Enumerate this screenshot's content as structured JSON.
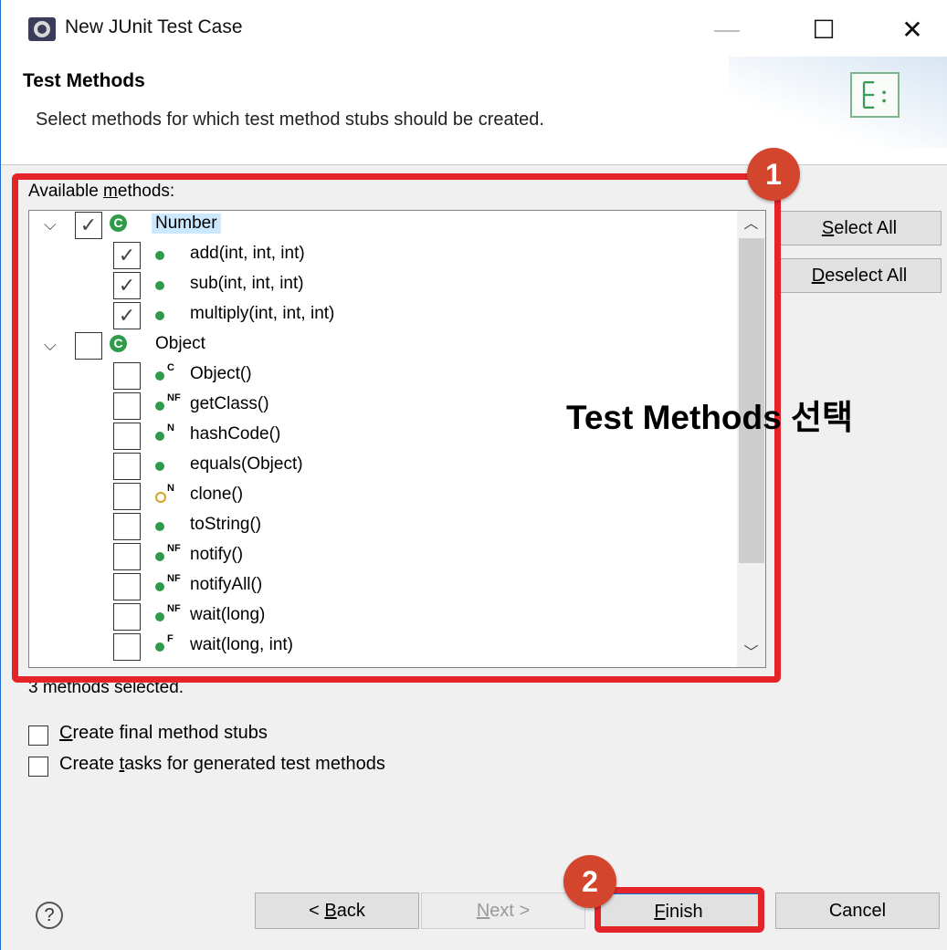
{
  "window": {
    "title": "New JUnit Test Case",
    "minimize": "—",
    "maximize": "☐",
    "close": "✕"
  },
  "header": {
    "title": "Test Methods",
    "description": "Select methods for which test method stubs should be created."
  },
  "tree": {
    "label": "Available methods:",
    "items": [
      {
        "label": "Number",
        "level": 0,
        "checked": true,
        "icon": "class-icon"
      },
      {
        "label": "add(int, int, int)",
        "level": 1,
        "checked": true,
        "icon": "public-method-icon",
        "modifier": ""
      },
      {
        "label": "sub(int, int, int)",
        "level": 1,
        "checked": true,
        "icon": "public-method-icon",
        "modifier": ""
      },
      {
        "label": "multiply(int, int, int)",
        "level": 1,
        "checked": true,
        "icon": "public-method-icon",
        "modifier": ""
      },
      {
        "label": "Object",
        "level": 0,
        "checked": false,
        "icon": "class-icon"
      },
      {
        "label": "Object()",
        "level": 1,
        "checked": false,
        "icon": "public-method-icon",
        "modifier": "C"
      },
      {
        "label": "getClass()",
        "level": 1,
        "checked": false,
        "icon": "public-method-icon",
        "modifier": "NF"
      },
      {
        "label": "hashCode()",
        "level": 1,
        "checked": false,
        "icon": "public-method-icon",
        "modifier": "N"
      },
      {
        "label": "equals(Object)",
        "level": 1,
        "checked": false,
        "icon": "public-method-icon",
        "modifier": ""
      },
      {
        "label": "clone()",
        "level": 1,
        "checked": false,
        "icon": "protected-method-icon",
        "modifier": "N"
      },
      {
        "label": "toString()",
        "level": 1,
        "checked": false,
        "icon": "public-method-icon",
        "modifier": ""
      },
      {
        "label": "notify()",
        "level": 1,
        "checked": false,
        "icon": "public-method-icon",
        "modifier": "NF"
      },
      {
        "label": "notifyAll()",
        "level": 1,
        "checked": false,
        "icon": "public-method-icon",
        "modifier": "NF"
      },
      {
        "label": "wait(long)",
        "level": 1,
        "checked": false,
        "icon": "public-method-icon",
        "modifier": "NF"
      },
      {
        "label": "wait(long, int)",
        "level": 1,
        "checked": false,
        "icon": "public-method-icon",
        "modifier": "F"
      }
    ]
  },
  "buttons": {
    "select_all": "Select All",
    "deselect_all": "Deselect All",
    "back": "< Back",
    "next": "Next >",
    "finish": "Finish",
    "cancel": "Cancel"
  },
  "status": "3 methods selected.",
  "options": {
    "final_stubs": "Create final method stubs",
    "tasks": "Create tasks for generated test methods"
  },
  "annotations": {
    "badge1": "1",
    "badge2": "2",
    "text": "Test Methods 선택",
    "color": "#e5232b"
  }
}
